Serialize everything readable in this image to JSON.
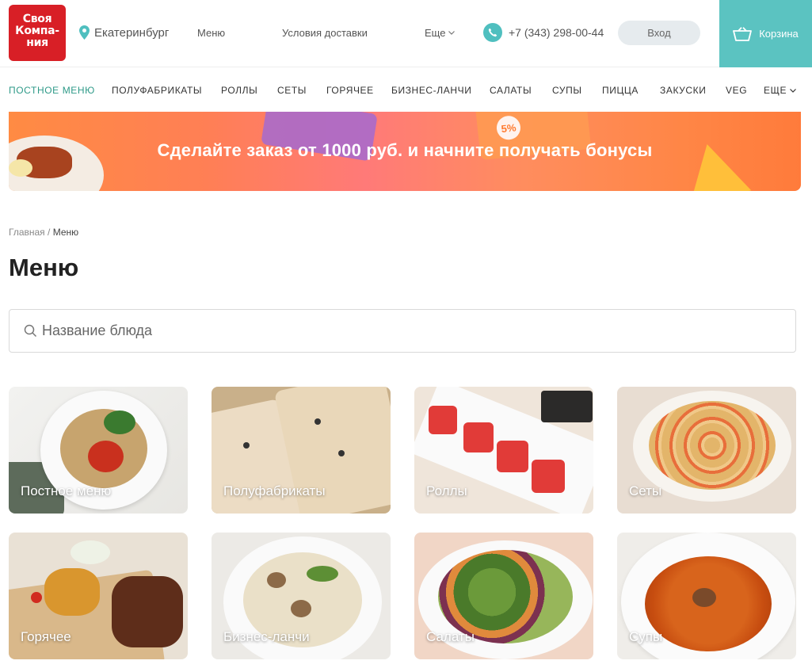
{
  "logo": {
    "line1": "Своя",
    "line2": "Компа-",
    "line3": "ния"
  },
  "header": {
    "city": "Екатеринбург",
    "menu_link": "Меню",
    "delivery_link": "Условия доставки",
    "more_link": "Еще",
    "phone": "+7 (343) 298-00-44",
    "login": "Вход",
    "cart": "Корзина"
  },
  "categories": [
    "ПОСТНОЕ МЕНЮ",
    "ПОЛУФАБРИКАТЫ",
    "РОЛЛЫ",
    "СЕТЫ",
    "ГОРЯЧЕЕ",
    "БИЗНЕС-ЛАНЧИ",
    "САЛАТЫ",
    "СУПЫ",
    "ПИЦЦА",
    "ЗАКУСКИ",
    "VEG",
    "ЕЩЕ"
  ],
  "banner": {
    "text": "Сделайте заказ от 1000 руб. и начните получать бонусы",
    "card_badge": "5%"
  },
  "breadcrumb": {
    "home": "Главная",
    "separator": "/",
    "current": "Меню"
  },
  "page": {
    "title": "Меню",
    "search_placeholder": "Название блюда"
  },
  "tiles": [
    "Постное меню",
    "Полуфабрикаты",
    "Роллы",
    "Сеты",
    "Горячее",
    "Бизнес-ланчи",
    "Салаты",
    "Супы"
  ],
  "colors": {
    "brand_red": "#d81f26",
    "accent_teal": "#5bc3c1",
    "active_category": "#2e9a88"
  }
}
